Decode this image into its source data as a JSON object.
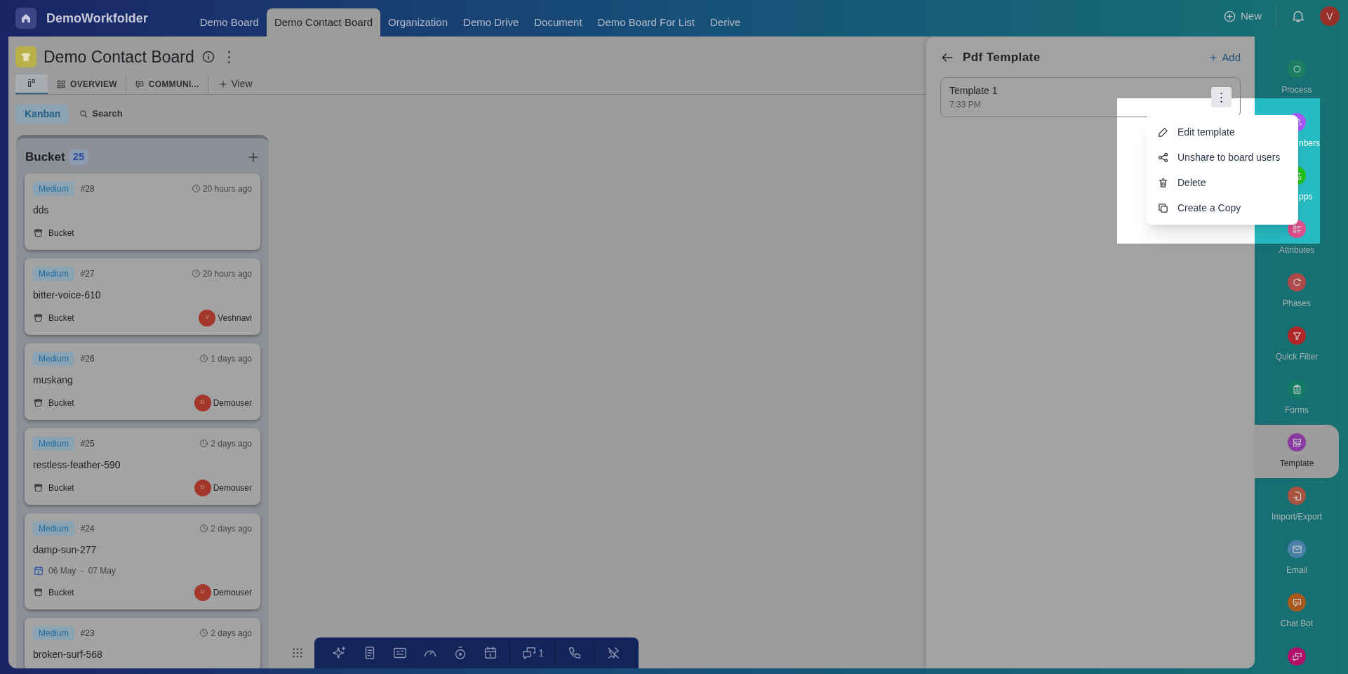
{
  "workspace": {
    "name": "DemoWorkfolder"
  },
  "top_tabs": [
    {
      "label": "Demo Board",
      "selected": false
    },
    {
      "label": "Demo Contact Board",
      "selected": true
    },
    {
      "label": "Organization",
      "selected": false
    },
    {
      "label": "Demo Drive",
      "selected": false
    },
    {
      "label": "Document",
      "selected": false
    },
    {
      "label": "Demo Board For List",
      "selected": false
    },
    {
      "label": "Derive",
      "selected": false
    }
  ],
  "top_actions": {
    "new_label": "New",
    "avatar": "V"
  },
  "board": {
    "title": "Demo Contact Board",
    "view_tabs": [
      {
        "kind": "board",
        "selected": true
      },
      {
        "kind": "overview",
        "label": "OVERVIEW",
        "selected": false
      },
      {
        "kind": "communication",
        "label": "COMMUNI...",
        "selected": false
      }
    ],
    "add_view": "View",
    "modes": [
      {
        "label": "Kanban",
        "selected": true
      }
    ],
    "search": "Search"
  },
  "column": {
    "title": "Bucket",
    "count": "25",
    "cards": [
      {
        "priority": "Medium",
        "number": "#28",
        "time": "20 hours ago",
        "title": "dds",
        "bucket": "Bucket"
      },
      {
        "priority": "Medium",
        "number": "#27",
        "time": "20 hours ago",
        "title": "bitter-voice-610",
        "bucket": "Bucket",
        "assignee": {
          "initial": "V",
          "name": "Veshnavi"
        }
      },
      {
        "priority": "Medium",
        "number": "#26",
        "time": "1 days ago",
        "title": "muskang",
        "bucket": "Bucket",
        "assignee": {
          "initial": "D",
          "name": "Demouser"
        }
      },
      {
        "priority": "Medium",
        "number": "#25",
        "time": "2 days ago",
        "title": "restless-feather-590",
        "bucket": "Bucket",
        "assignee": {
          "initial": "D",
          "name": "Demouser"
        }
      },
      {
        "priority": "Medium",
        "number": "#24",
        "time": "2 days ago",
        "title": "damp-sun-277",
        "dates": "06 May  -  07 May",
        "bucket": "Bucket",
        "assignee": {
          "initial": "D",
          "name": "Demouser"
        }
      },
      {
        "priority": "Medium",
        "number": "#23",
        "time": "2 days ago",
        "title": "broken-surf-568"
      }
    ]
  },
  "panel": {
    "title": "Pdf Template",
    "add_label": "Add",
    "templates": [
      {
        "name": "Template 1",
        "time": "7:33 PM"
      }
    ]
  },
  "context_menu": [
    {
      "kind": "edit",
      "label": "Edit template"
    },
    {
      "kind": "share",
      "label": "Unshare to board users"
    },
    {
      "kind": "delete",
      "label": "Delete"
    },
    {
      "kind": "copy",
      "label": "Create a Copy"
    }
  ],
  "sidebar": [
    {
      "kind": "process",
      "label": "Process",
      "color": "#1a7f60",
      "selected": false,
      "clipped": false
    },
    {
      "kind": "members",
      "label": "nbers",
      "color": "#a855f7",
      "selected": false,
      "clipped": true
    },
    {
      "kind": "apps",
      "label": "pps",
      "color": "#22c216",
      "selected": false,
      "clipped": true
    },
    {
      "kind": "attributes",
      "label": "Attributes",
      "color": "#e0508f",
      "selected": false,
      "clipped": false
    },
    {
      "kind": "phases",
      "label": "Phases",
      "color": "#b04a4a",
      "selected": false,
      "clipped": false
    },
    {
      "kind": "filter",
      "label": "Quick Filter",
      "color": "#b02626",
      "selected": false,
      "clipped": false
    },
    {
      "kind": "forms",
      "label": "Forms",
      "color": "#137a66",
      "selected": false,
      "clipped": false
    },
    {
      "kind": "template",
      "label": "Template",
      "color": "#8a3ba0",
      "selected": true,
      "clipped": false
    },
    {
      "kind": "import",
      "label": "Import/Export",
      "color": "#a8533f",
      "selected": false,
      "clipped": false
    },
    {
      "kind": "email",
      "label": "Email",
      "color": "#4a7fa6",
      "selected": false,
      "clipped": false
    },
    {
      "kind": "chatbot",
      "label": "Chat Bot",
      "color": "#a85a1e",
      "selected": false,
      "clipped": false
    },
    {
      "kind": "messages",
      "color": "#b0106a",
      "selected": false
    }
  ],
  "toolbar": [
    {
      "kind": "sparkles"
    },
    {
      "kind": "document"
    },
    {
      "kind": "card"
    },
    {
      "kind": "gauge"
    },
    {
      "kind": "timer"
    },
    {
      "kind": "calendar"
    },
    {
      "kind": "chat",
      "count": "1"
    },
    {
      "kind": "phone"
    },
    {
      "kind": "unpin"
    }
  ]
}
